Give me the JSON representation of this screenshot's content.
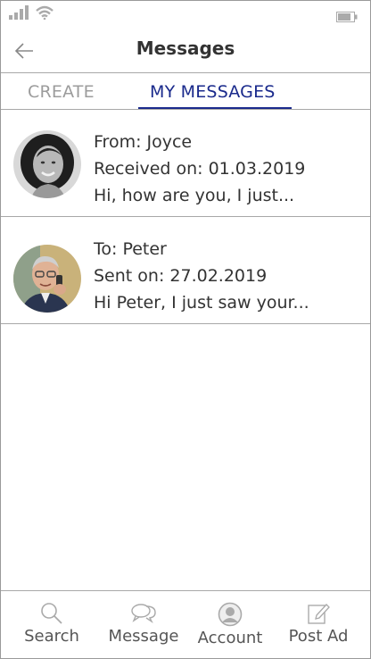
{
  "header": {
    "title": "Messages"
  },
  "tabs": [
    {
      "label": "CREATE"
    },
    {
      "label": "MY MESSAGES"
    }
  ],
  "messages": [
    {
      "line1": "From: Joyce",
      "line2": "Received on: 01.03.2019",
      "line3": "Hi, how are you, I just..."
    },
    {
      "line1": "To: Peter",
      "line2": "Sent on: 27.02.2019",
      "line3": "Hi Peter, I just saw your..."
    }
  ],
  "nav": [
    {
      "label": "Search",
      "icon": "search-icon"
    },
    {
      "label": "Message",
      "icon": "chat-bubbles-icon"
    },
    {
      "label": "Account",
      "icon": "user-icon"
    },
    {
      "label": "Post Ad",
      "icon": "edit-note-icon"
    }
  ],
  "colors": {
    "accent": "#1a2a8c",
    "muted": "#9c9c9c",
    "divider": "#a8a8a8"
  }
}
